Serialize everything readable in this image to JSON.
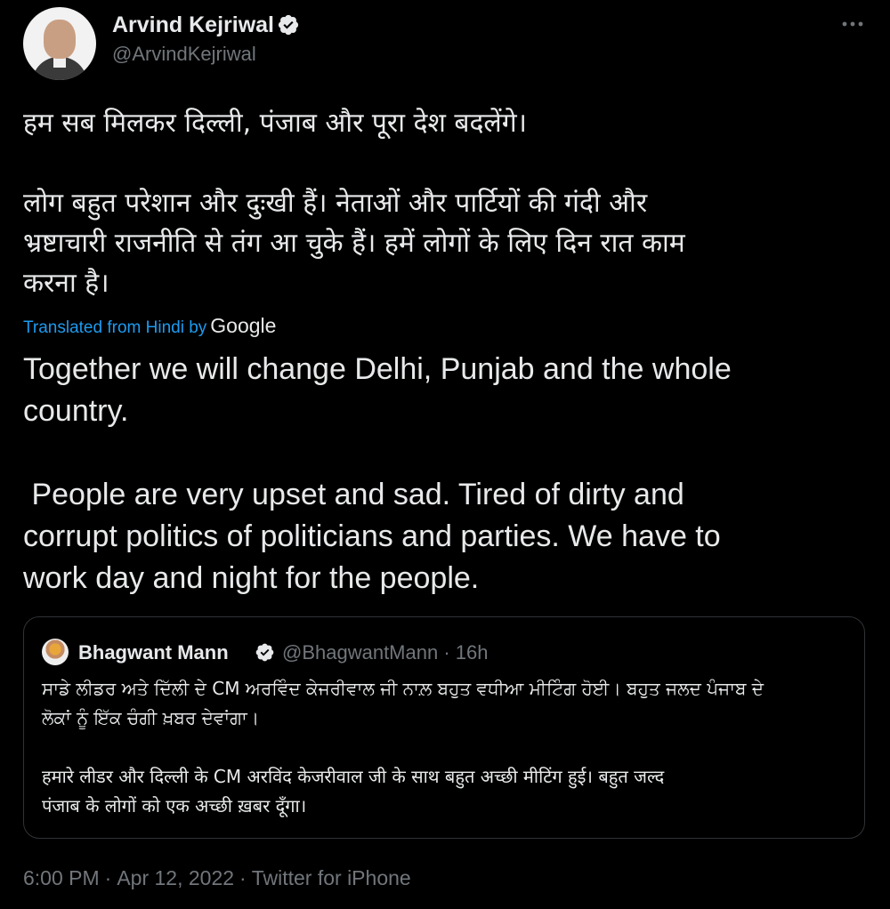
{
  "author": {
    "name": "Arvind Kejriwal",
    "handle": "@ArvindKejriwal",
    "verified_icon": "verified-badge-icon",
    "more_icon": "more-options-icon"
  },
  "tweet": {
    "text_hindi": "हम सब मिलकर दिल्ली, पंजाब और पूरा देश बदलेंगे।\n\nलोग बहुत परेशान और दुःखी हैं। नेताओं और पार्टियों की गंदी और\nभ्रष्टाचारी राजनीति से तंग आ चुके हैं। हमें लोगों के लिए दिन रात काम\nकरना है।",
    "translation_label": "Translated from Hindi by",
    "translation_provider": "Google",
    "text_english": "Together we will change Delhi, Punjab and the whole\ncountry.\n\n People are very upset and sad. Tired of dirty and\ncorrupt politics of politicians and parties. We have to\nwork day and night for the people."
  },
  "quoted_tweet": {
    "name": "Bhagwant Mann",
    "handle": "@BhagwantMann",
    "separator": "·",
    "time": "16h",
    "text": "ਸਾਡੇ ਲੀਡਰ ਅਤੇ ਦਿੱਲੀ ਦੇ CM ਅਰਵਿੰਦ ਕੇਜਰੀਵਾਲ ਜੀ ਨਾਲ਼ ਬਹੁਤ ਵਧੀਆ ਮੀਟਿੰਗ ਹੋਈ। ਬਹੁਤ ਜਲਦ ਪੰਜਾਬ ਦੇ\nਲੋਕਾਂ ਨੂੰ ਇੱਕ ਚੰਗੀ ਖ਼ਬਰ ਦੇਵਾਂਗਾ।\n\nहमारे लीडर और दिल्ली के CM अरविंद केजरीवाल जी के साथ बहुत अच्छी मीटिंग हुई। बहुत जल्द\nपंजाब के लोगों को एक अच्छी ख़बर दूँगा।"
  },
  "meta": {
    "time": "6:00 PM",
    "separator": "·",
    "date": "Apr 12, 2022",
    "source": "Twitter for iPhone"
  },
  "colors": {
    "background": "#000000",
    "text": "#e7e9ea",
    "secondary": "#71767b",
    "link": "#1d9bf0",
    "border": "#2f3336",
    "verified": "#e7e9ea"
  }
}
